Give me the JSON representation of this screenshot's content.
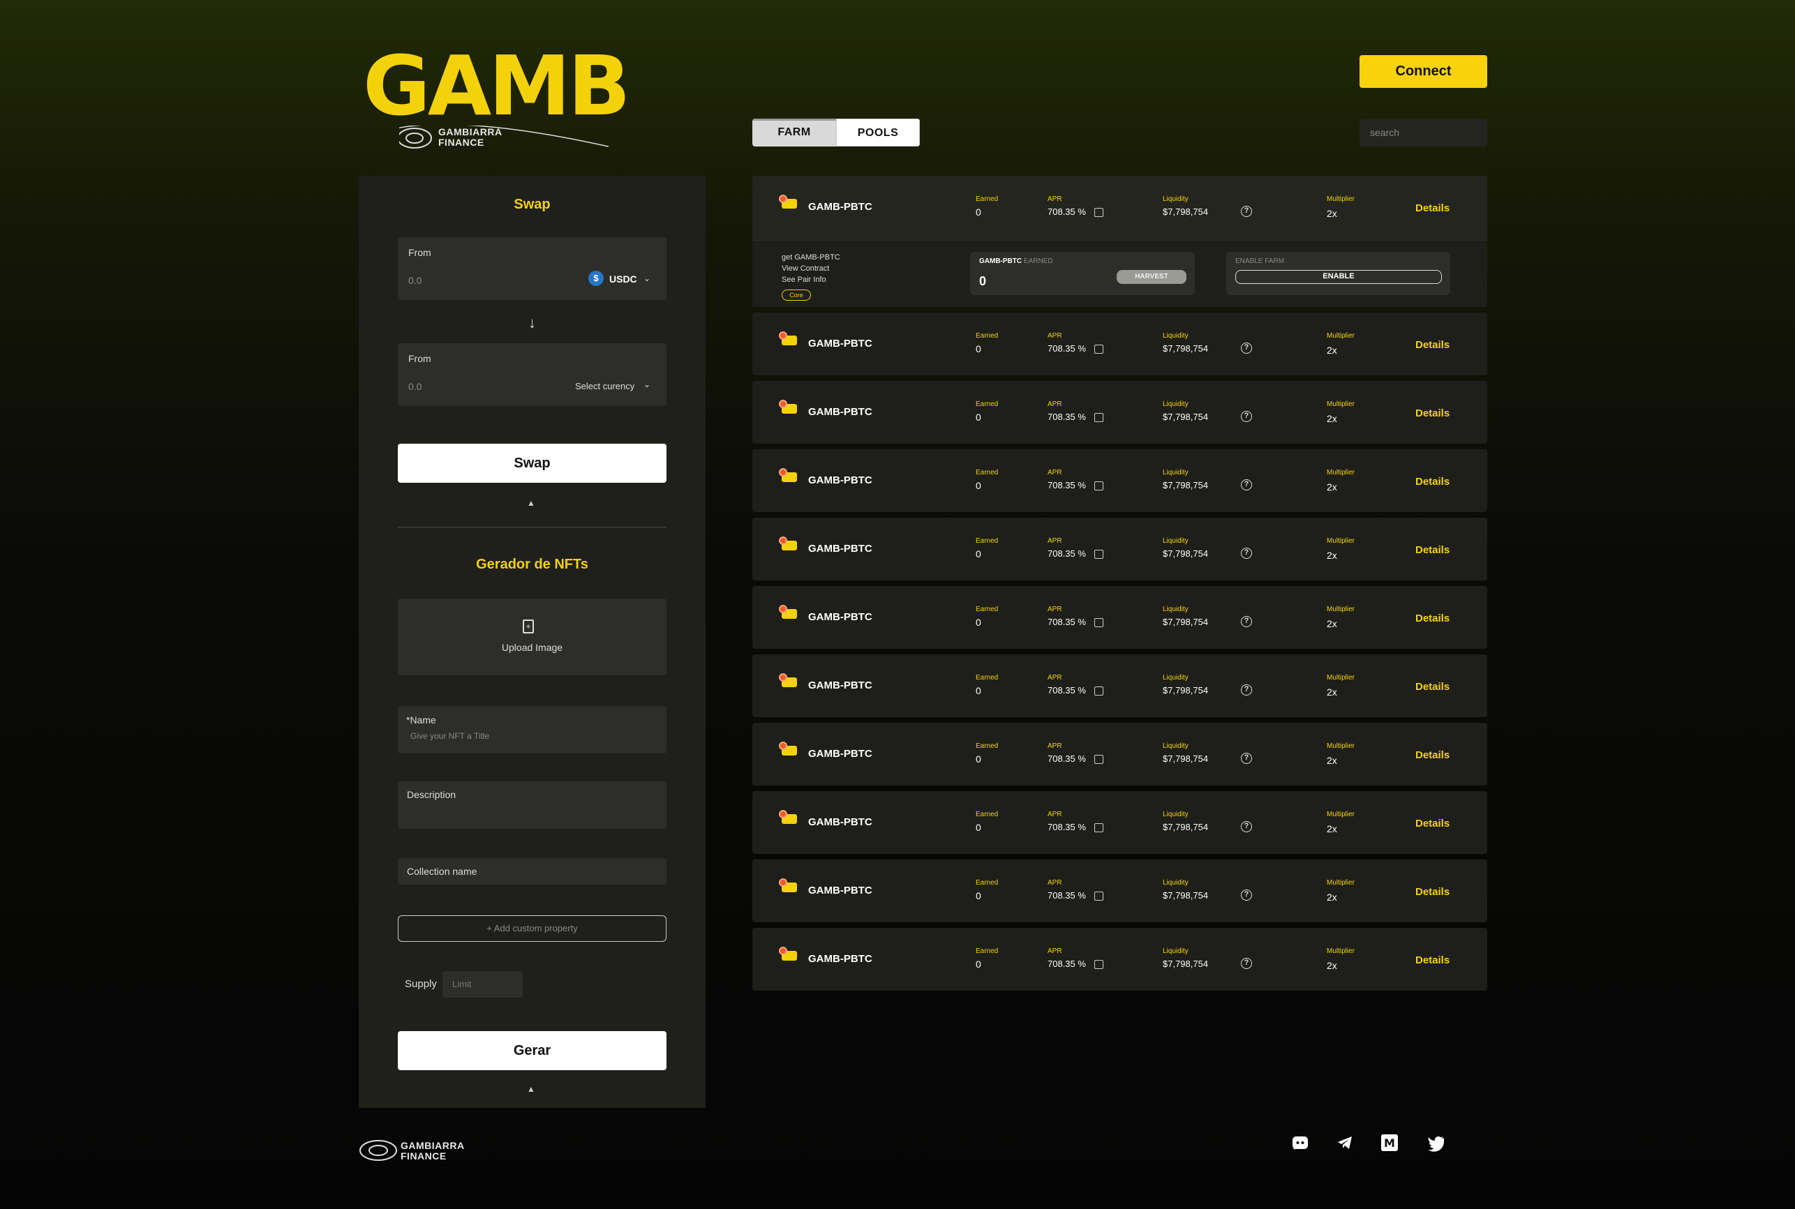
{
  "brand": {
    "logo_text": "GAMB",
    "sub_line1": "GAMBIARRA",
    "sub_line2": "FINANCE",
    "accent": "#f4d20b"
  },
  "header": {
    "connect_label": "Connect",
    "tabs": [
      {
        "label": "FARM"
      },
      {
        "label": "POOLS"
      }
    ],
    "search_placeholder": "search"
  },
  "swap": {
    "title": "Swap",
    "from": {
      "label": "From",
      "value": "0.0",
      "token": "USDC"
    },
    "to": {
      "label": "From",
      "value": "0.0",
      "select_label": "Select curency"
    },
    "button_label": "Swap"
  },
  "nft": {
    "title": "Gerador de NFTs",
    "upload_label": "Upload Image",
    "name_label": "*Name",
    "name_placeholder": "Give your NFT a Title",
    "description_label": "Description",
    "collection_label": "Collection name",
    "add_property_label": "+ Add custom property",
    "supply_label": "Supply",
    "supply_placeholder": "Limit",
    "button_label": "Gerar"
  },
  "farm": {
    "labels": {
      "earned": "Earned",
      "apr": "APR",
      "liquidity": "Liquidity",
      "multiplier": "Multiplier",
      "details": "Details"
    },
    "expanded": {
      "links": [
        "get GAMB-PBTC",
        "View Contract",
        "See Pair Info"
      ],
      "badge": "Core",
      "earned_pair": "GAMB-PBTC",
      "earned_suffix": "EARNED",
      "earned_value": "0",
      "harvest_label": "HARVEST",
      "enable_title": "ENABLE FARM",
      "enable_label": "ENABLE"
    },
    "rows": [
      {
        "pair": "GAMB-PBTC",
        "earned": "0",
        "apr": "708.35",
        "apr_unit": "%",
        "liquidity": "$7,798,754",
        "multiplier": "2x"
      },
      {
        "pair": "GAMB-PBTC",
        "earned": "0",
        "apr": "708.35",
        "apr_unit": "%",
        "liquidity": "$7,798,754",
        "multiplier": "2x"
      },
      {
        "pair": "GAMB-PBTC",
        "earned": "0",
        "apr": "708.35",
        "apr_unit": "%",
        "liquidity": "$7,798,754",
        "multiplier": "2x"
      },
      {
        "pair": "GAMB-PBTC",
        "earned": "0",
        "apr": "708.35",
        "apr_unit": "%",
        "liquidity": "$7,798,754",
        "multiplier": "2x"
      },
      {
        "pair": "GAMB-PBTC",
        "earned": "0",
        "apr": "708.35",
        "apr_unit": "%",
        "liquidity": "$7,798,754",
        "multiplier": "2x"
      },
      {
        "pair": "GAMB-PBTC",
        "earned": "0",
        "apr": "708.35",
        "apr_unit": "%",
        "liquidity": "$7,798,754",
        "multiplier": "2x"
      },
      {
        "pair": "GAMB-PBTC",
        "earned": "0",
        "apr": "708.35",
        "apr_unit": "%",
        "liquidity": "$7,798,754",
        "multiplier": "2x"
      },
      {
        "pair": "GAMB-PBTC",
        "earned": "0",
        "apr": "708.35",
        "apr_unit": "%",
        "liquidity": "$7,798,754",
        "multiplier": "2x"
      },
      {
        "pair": "GAMB-PBTC",
        "earned": "0",
        "apr": "708.35",
        "apr_unit": "%",
        "liquidity": "$7,798,754",
        "multiplier": "2x"
      },
      {
        "pair": "GAMB-PBTC",
        "earned": "0",
        "apr": "708.35",
        "apr_unit": "%",
        "liquidity": "$7,798,754",
        "multiplier": "2x"
      },
      {
        "pair": "GAMB-PBTC",
        "earned": "0",
        "apr": "708.35",
        "apr_unit": "%",
        "liquidity": "$7,798,754",
        "multiplier": "2x"
      }
    ]
  },
  "footer": {
    "brand_line1": "GAMBIARRA",
    "brand_line2": "FINANCE",
    "social": [
      "discord-icon",
      "telegram-icon",
      "medium-icon",
      "twitter-icon"
    ]
  }
}
